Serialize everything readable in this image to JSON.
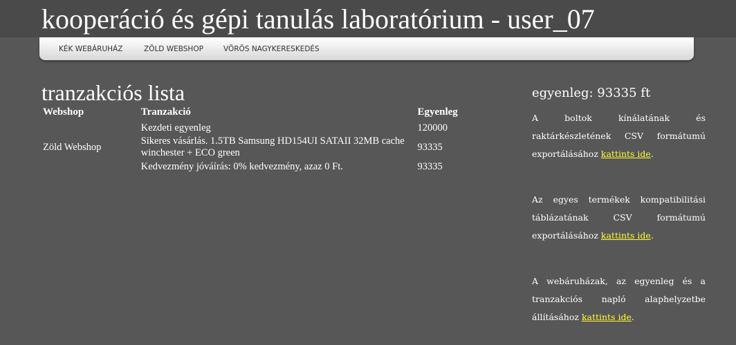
{
  "header": {
    "title": "kooperáció és gépi tanulás laboratórium - user_07"
  },
  "nav": {
    "items": [
      {
        "label": "KÉK WEBÁRUHÁZ"
      },
      {
        "label": "ZÖLD WEBSHOP"
      },
      {
        "label": "VÖRÖS NAGYKERESKEDÉS"
      }
    ]
  },
  "main": {
    "heading": "tranzakciós lista",
    "table": {
      "headers": [
        "Webshop",
        "Tranzakció",
        "Egyenleg"
      ],
      "rows": [
        {
          "webshop": "",
          "transaction": "Kezdeti egyenleg",
          "balance": "120000"
        },
        {
          "webshop": "Zöld Webshop",
          "transaction": "Sikeres vásárlás. 1.5TB Samsung HD154UI SATAII 32MB cache winchester + ECO green",
          "balance": "93335"
        },
        {
          "webshop": "",
          "transaction": "Kedvezmény jóváírás: 0% kedvezmény, azaz 0 Ft.",
          "balance": "93335"
        }
      ]
    }
  },
  "sidebar": {
    "balance": "egyenleg: 93335 ft",
    "paragraphs": [
      {
        "text": "A boltok kínálatának és raktárkészletének CSV formátumú exportálásához ",
        "link": "kattints ide",
        "after": "."
      },
      {
        "text": "Az egyes termékek kompatibilitási táblázatának CSV formátumú exportálásához ",
        "link": "kattints ide",
        "after": "."
      },
      {
        "text": "A webáruházak, az egyenleg és a tranzakciós napló alaphelyzetbe állításához ",
        "link": "kattints ide",
        "after": "."
      }
    ]
  },
  "colors": {
    "background": "#575757",
    "topbar": "#4a4a4a",
    "link": "#ffff33",
    "text": "#ffffff"
  }
}
